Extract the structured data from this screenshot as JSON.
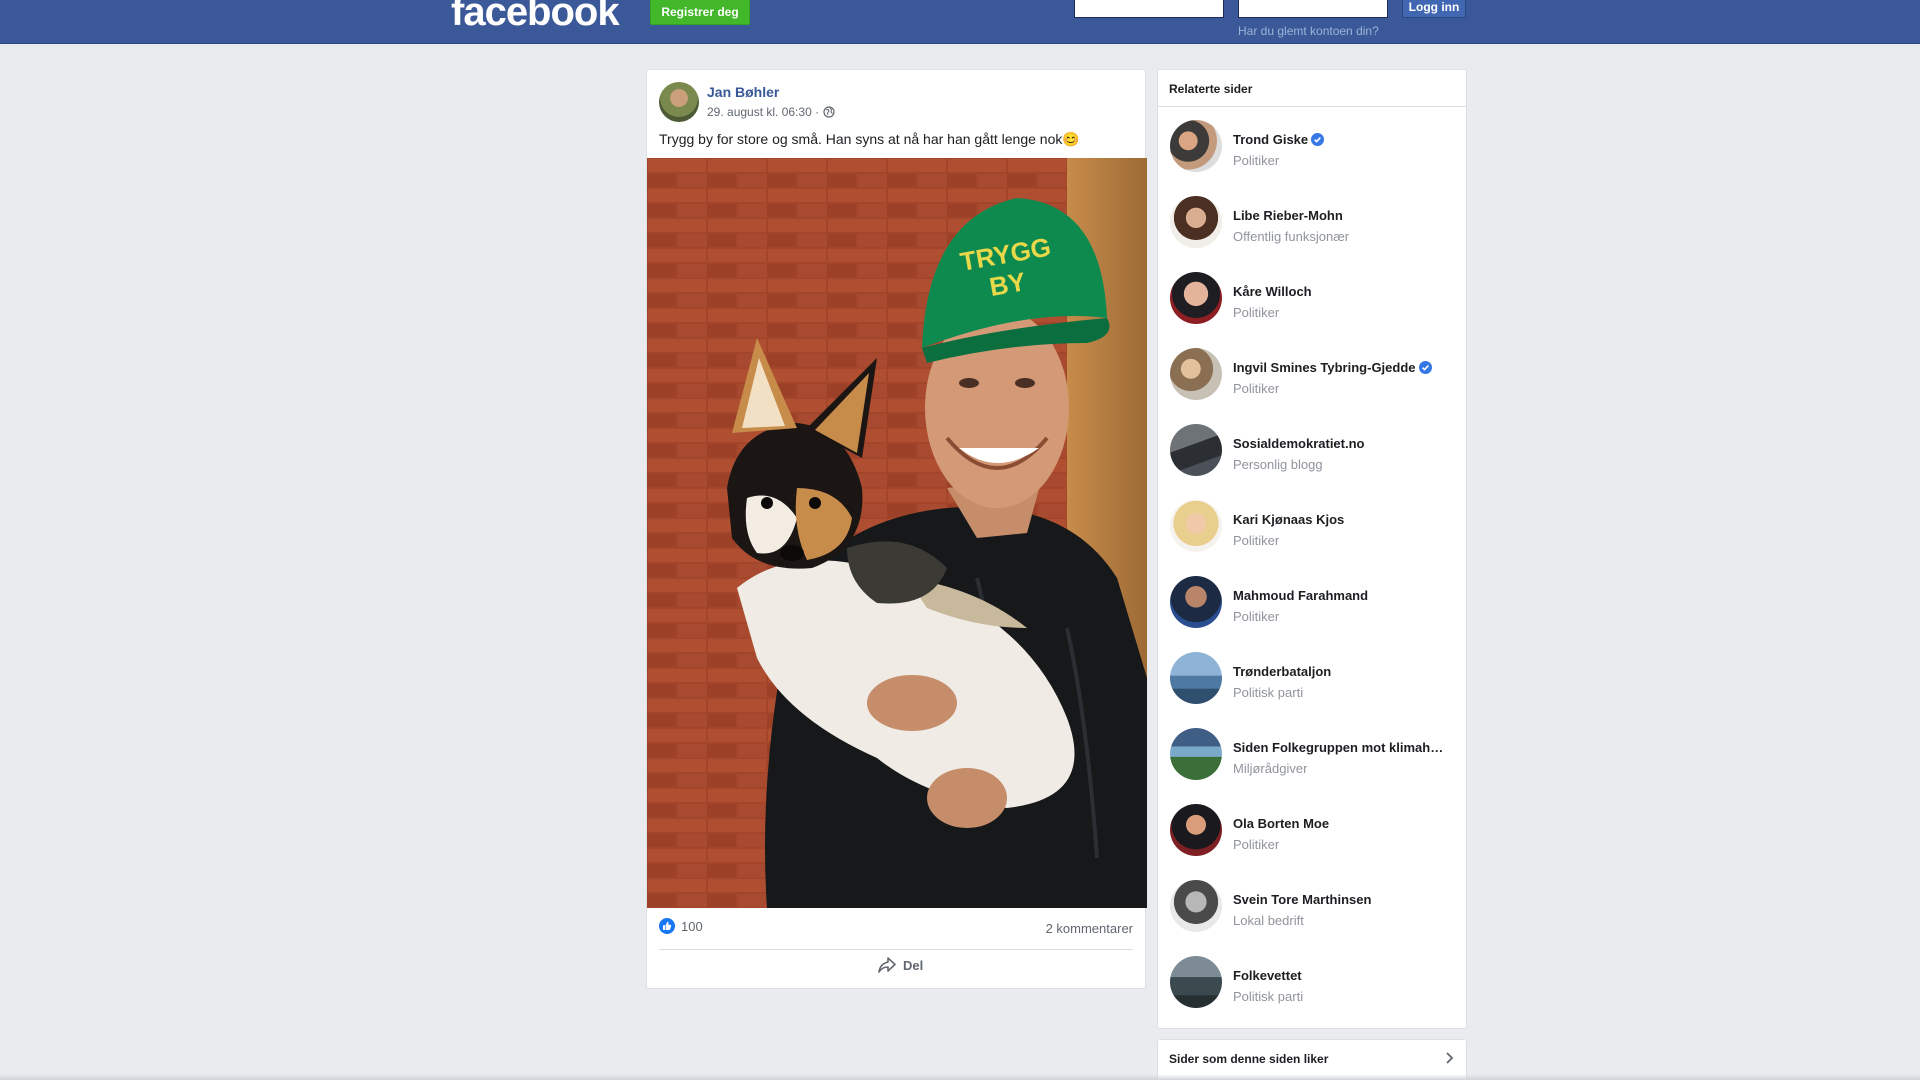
{
  "header": {
    "logo": "facebook",
    "register_label": "Registrer deg",
    "login_label": "Logg inn",
    "forgot_link": "Har du glemt kontoen din?"
  },
  "post": {
    "author": "Jan Bøhler",
    "timestamp": "29. august kl. 06:30 ·",
    "text": "Trygg by for store og små. Han syns at nå har han gått lenge nok😊",
    "cap_text_1": "TRYGG",
    "cap_text_2": "BY",
    "likes": "100",
    "comments": "2 kommentarer",
    "share_label": "Del"
  },
  "related": {
    "title": "Relaterte sider",
    "items": [
      {
        "name": "Trond Giske",
        "subtitle": "Politiker",
        "verified": true
      },
      {
        "name": "Libe Rieber-Mohn",
        "subtitle": "Offentlig funksjonær",
        "verified": false
      },
      {
        "name": "Kåre Willoch",
        "subtitle": "Politiker",
        "verified": false
      },
      {
        "name": "Ingvil Smines Tybring-Gjedde",
        "subtitle": "Politiker",
        "verified": true
      },
      {
        "name": "Sosialdemokratiet.no",
        "subtitle": "Personlig blogg",
        "verified": false
      },
      {
        "name": "Kari Kjønaas Kjos",
        "subtitle": "Politiker",
        "verified": false
      },
      {
        "name": "Mahmoud Farahmand",
        "subtitle": "Politiker",
        "verified": false
      },
      {
        "name": "Trønderbataljon",
        "subtitle": "Politisk parti",
        "verified": false
      },
      {
        "name": "Siden Folkegruppen mot klimah…",
        "subtitle": "Miljørådgiver",
        "verified": false
      },
      {
        "name": "Ola Borten Moe",
        "subtitle": "Politiker",
        "verified": false
      },
      {
        "name": "Svein Tore Marthinsen",
        "subtitle": "Lokal bedrift",
        "verified": false
      },
      {
        "name": "Folkevettet",
        "subtitle": "Politisk parti",
        "verified": false
      }
    ]
  },
  "liked_pages": {
    "title": "Sider som denne siden liker"
  },
  "colors": {
    "header_bg": "#3b5998",
    "register_green": "#42b72a",
    "link_blue": "#385898",
    "page_bg": "#e9ebee",
    "verified_blue": "#3578e5"
  }
}
